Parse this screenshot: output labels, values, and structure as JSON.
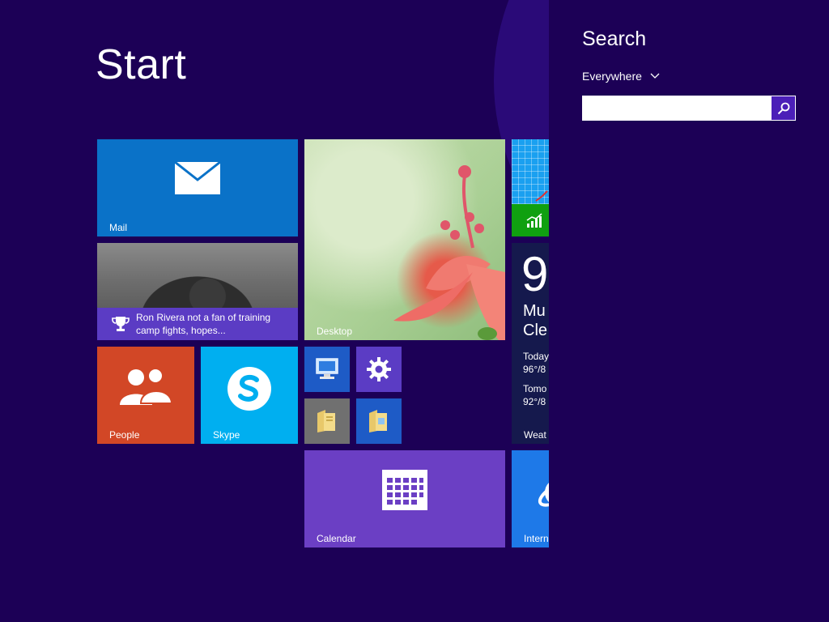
{
  "start": {
    "title": "Start",
    "tiles": {
      "mail": {
        "label": "Mail"
      },
      "news": {
        "headline": "Ron Rivera not a fan of training camp fights, hopes..."
      },
      "desktop": {
        "label": "Desktop"
      },
      "people": {
        "label": "People"
      },
      "skype": {
        "label": "Skype"
      },
      "calendar": {
        "label": "Calendar"
      },
      "weather": {
        "temp": "9",
        "city_line1": "Mu",
        "city_line2": "Cle",
        "today_label": "Today",
        "today_range": "96°/8",
        "tomorrow_label": "Tomo",
        "tomorrow_range": "92°/8",
        "label": "Weat"
      },
      "ie": {
        "label": "Intern"
      }
    }
  },
  "search": {
    "heading": "Search",
    "scope": "Everywhere",
    "query": "",
    "placeholder": ""
  },
  "colors": {
    "background": "#1c0056",
    "mail": "#0a72c8",
    "people": "#d24726",
    "skype": "#00aff0",
    "calendar": "#6b3fc4",
    "search_button": "#4b1fb8"
  },
  "icons": {
    "mail": "envelope-icon",
    "news": "trophy-icon",
    "people": "people-icon",
    "skype": "skype-icon",
    "this_pc": "computer-icon",
    "pc_settings": "gear-icon",
    "documents": "folder-icon",
    "file_explorer": "folder-icon",
    "calendar": "calendar-icon",
    "finance": "chart-icon",
    "ie": "ie-icon",
    "search": "magnifier-icon",
    "scope": "chevron-down-icon"
  }
}
